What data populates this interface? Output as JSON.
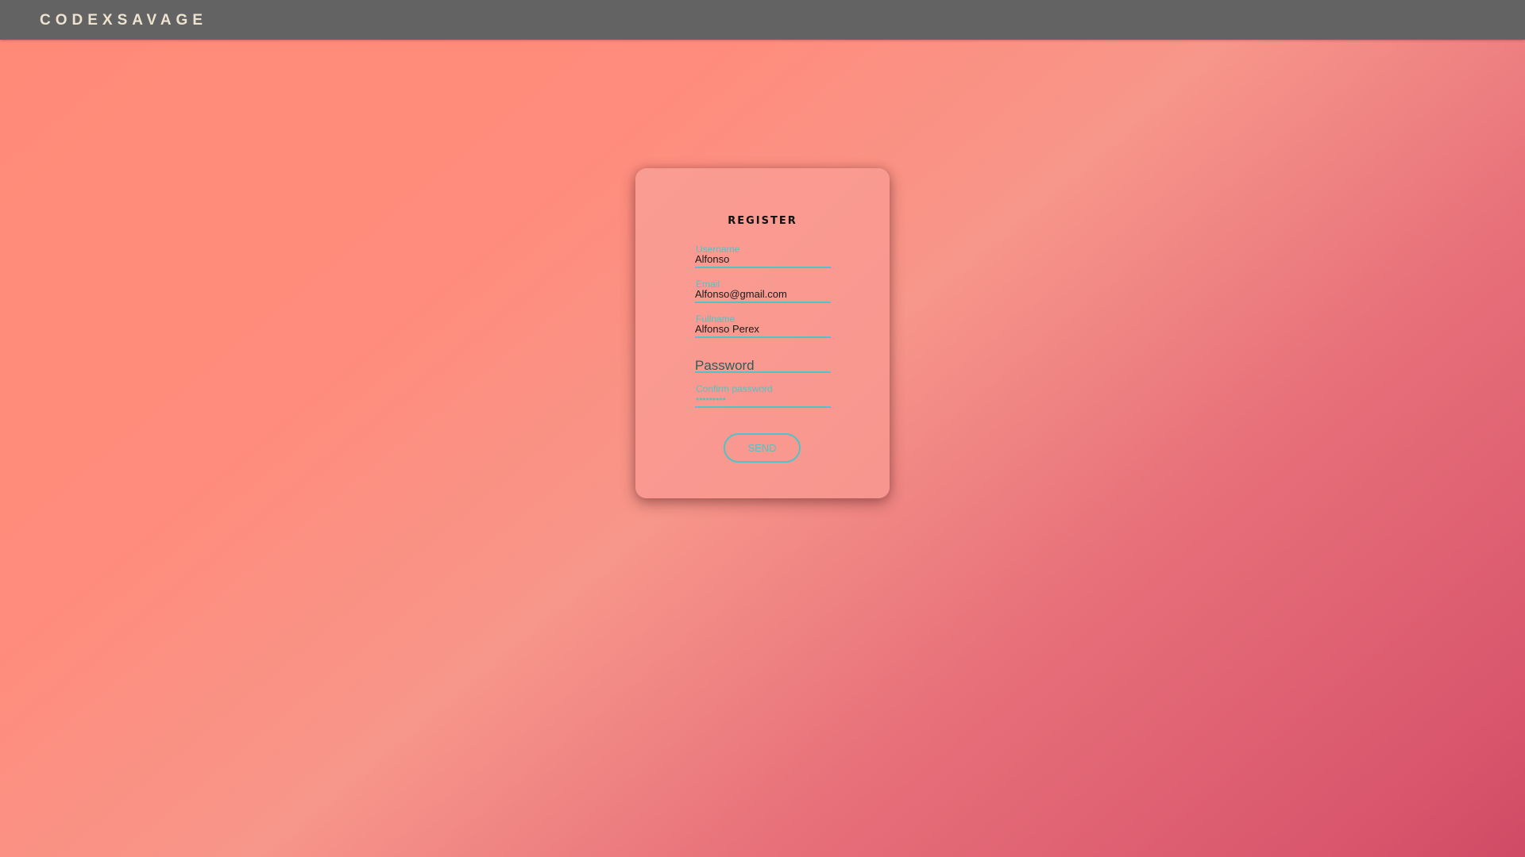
{
  "header": {
    "brand": "CODEXSAVAGE"
  },
  "form": {
    "title": "REGISTER",
    "fields": {
      "username": {
        "label": "Username",
        "value": "Alfonso"
      },
      "email": {
        "label": "Email",
        "value": "Alfonso@gmail.com"
      },
      "fullname": {
        "label": "Fullname",
        "value": "Alfonso Perex"
      },
      "password": {
        "placeholder": "Password"
      },
      "confirm_password": {
        "label": "Confirm password",
        "value": "•••••••••"
      }
    },
    "submit_label": "SEND"
  },
  "colors": {
    "accent": "#4fc3c8",
    "topbar": "#636363",
    "brand_text": "#ede3cf",
    "card": "#fb9c92"
  }
}
